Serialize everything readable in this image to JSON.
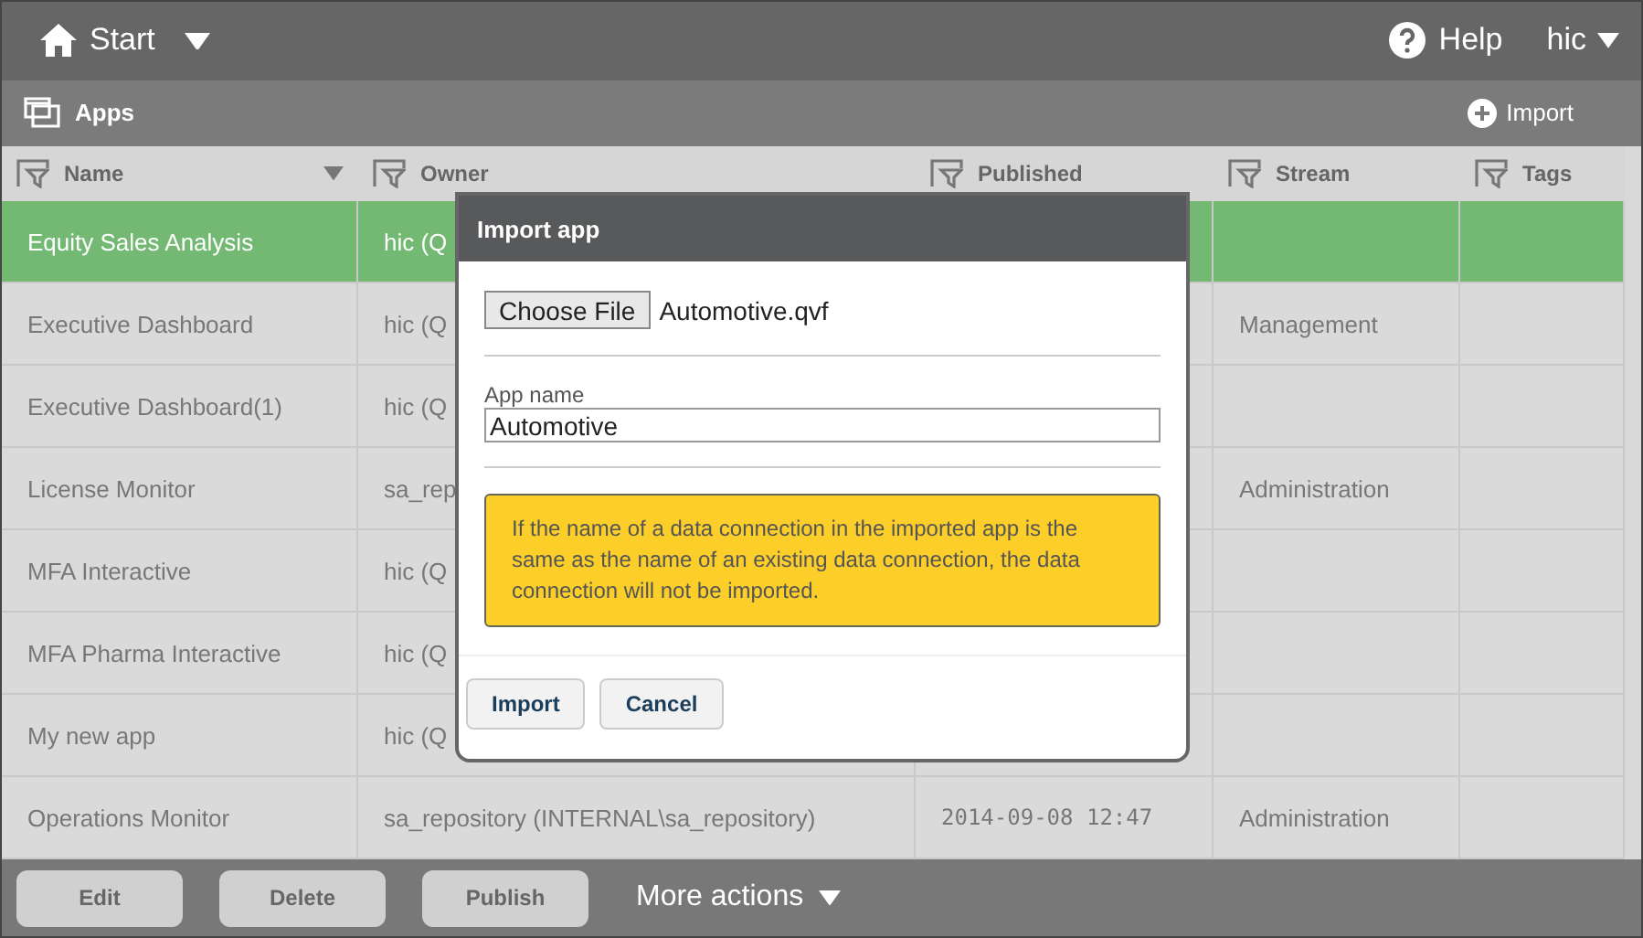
{
  "top_bar": {
    "start": "Start",
    "help": "Help",
    "user": "hic"
  },
  "apps_bar": {
    "title": "Apps",
    "import": "Import"
  },
  "table": {
    "columns": [
      {
        "label": "Name",
        "sorted": true
      },
      {
        "label": "Owner",
        "sorted": false
      },
      {
        "label": "Published",
        "sorted": false
      },
      {
        "label": "Stream",
        "sorted": false
      },
      {
        "label": "Tags",
        "sorted": false
      }
    ],
    "rows": [
      {
        "selected": true,
        "name": "Equity Sales Analysis",
        "owner": "hic (Q"
      },
      {
        "selected": false,
        "name": "Executive Dashboard",
        "owner": "hic (Q",
        "stream": "Management"
      },
      {
        "selected": false,
        "name": "Executive Dashboard(1)",
        "owner": "hic (Q"
      },
      {
        "selected": false,
        "name": "License Monitor",
        "owner": "sa_rep",
        "stream": "Administration"
      },
      {
        "selected": false,
        "name": "MFA Interactive",
        "owner": "hic (Q"
      },
      {
        "selected": false,
        "name": "MFA Pharma Interactive",
        "owner": "hic (Q"
      },
      {
        "selected": false,
        "name": "My new app",
        "owner": "hic (Q"
      },
      {
        "selected": false,
        "name": "Operations Monitor",
        "owner": "sa_repository (INTERNAL\\sa_repository)",
        "published": "2014-09-08 12:47",
        "stream": "Administration"
      }
    ]
  },
  "dialog": {
    "title": "Import app",
    "choose_file": "Choose File",
    "file_name": "Automotive.qvf",
    "app_name_label": "App name",
    "app_name_value": "Automotive",
    "warning": "If the name of a data connection in the imported app is the same as the name of an existing data connection, the data connection will not be imported.",
    "buttons": [
      "Import",
      "Cancel"
    ]
  },
  "footer": {
    "buttons": [
      "Edit",
      "Delete",
      "Publish"
    ],
    "more": "More actions"
  }
}
